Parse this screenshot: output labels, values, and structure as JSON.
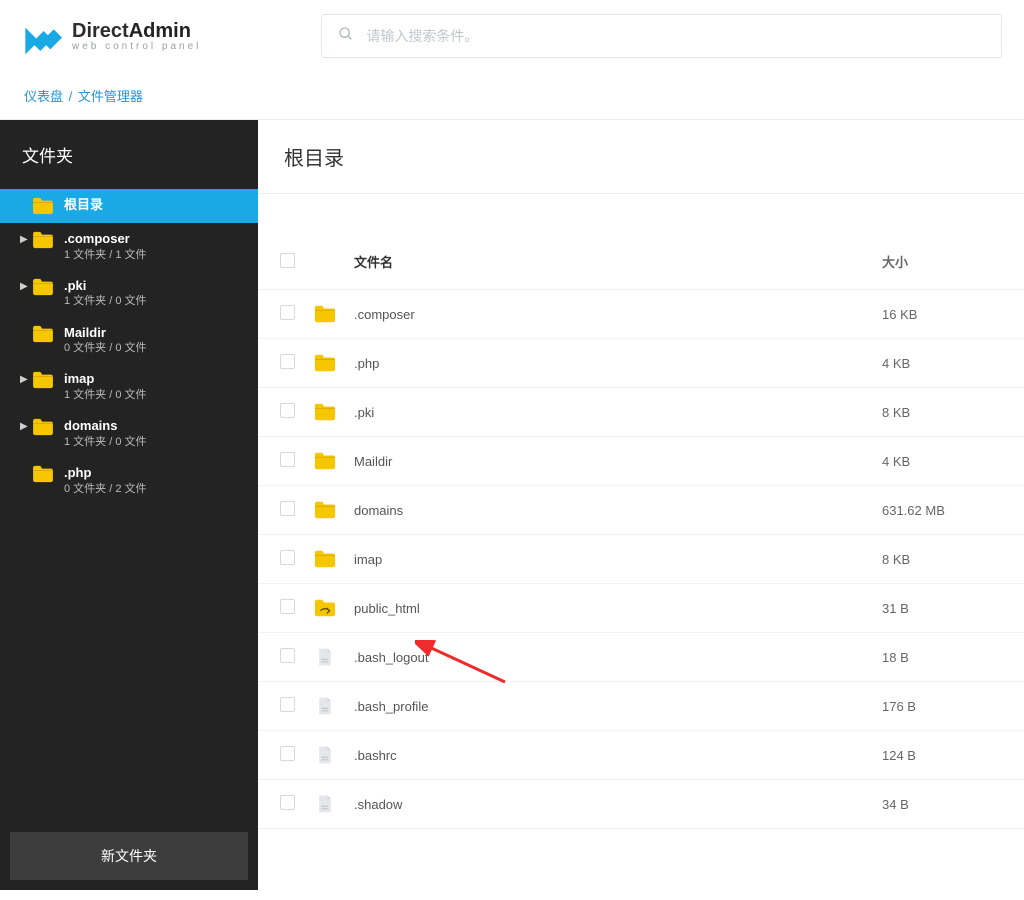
{
  "header": {
    "brand_line1": "Direct",
    "brand_line1b": "Admin",
    "brand_line2": "web control panel",
    "search_placeholder": "请输入搜索条件。"
  },
  "breadcrumb": {
    "dashboard": "仪表盘",
    "current": "文件管理器"
  },
  "sidebar": {
    "title": "文件夹",
    "new_folder_label": "新文件夹",
    "items": [
      {
        "name": "根目录",
        "meta": "",
        "active": true,
        "caret": false
      },
      {
        "name": ".composer",
        "meta": "1 文件夹 / 1 文件",
        "caret": true
      },
      {
        "name": ".pki",
        "meta": "1 文件夹 / 0 文件",
        "caret": true
      },
      {
        "name": "Maildir",
        "meta": "0 文件夹 / 0 文件",
        "caret": false
      },
      {
        "name": "imap",
        "meta": "1 文件夹 / 0 文件",
        "caret": true
      },
      {
        "name": "domains",
        "meta": "1 文件夹 / 0 文件",
        "caret": true
      },
      {
        "name": ".php",
        "meta": "0 文件夹 / 2 文件",
        "caret": false
      }
    ]
  },
  "content": {
    "title": "根目录",
    "columns": {
      "name": "文件名",
      "size": "大小"
    },
    "rows": [
      {
        "type": "folder",
        "name": ".composer",
        "size": "16 KB"
      },
      {
        "type": "folder",
        "name": ".php",
        "size": "4 KB"
      },
      {
        "type": "folder",
        "name": ".pki",
        "size": "8 KB"
      },
      {
        "type": "folder",
        "name": "Maildir",
        "size": "4 KB"
      },
      {
        "type": "folder",
        "name": "domains",
        "size": "631.62 MB"
      },
      {
        "type": "folder",
        "name": "imap",
        "size": "8 KB"
      },
      {
        "type": "link",
        "name": "public_html",
        "size": "31 B"
      },
      {
        "type": "file",
        "name": ".bash_logout",
        "size": "18 B"
      },
      {
        "type": "file",
        "name": ".bash_profile",
        "size": "176 B"
      },
      {
        "type": "file",
        "name": ".bashrc",
        "size": "124 B"
      },
      {
        "type": "file",
        "name": ".shadow",
        "size": "34 B"
      }
    ]
  },
  "colors": {
    "accent": "#19a9e5",
    "folder": "#f6c701"
  }
}
